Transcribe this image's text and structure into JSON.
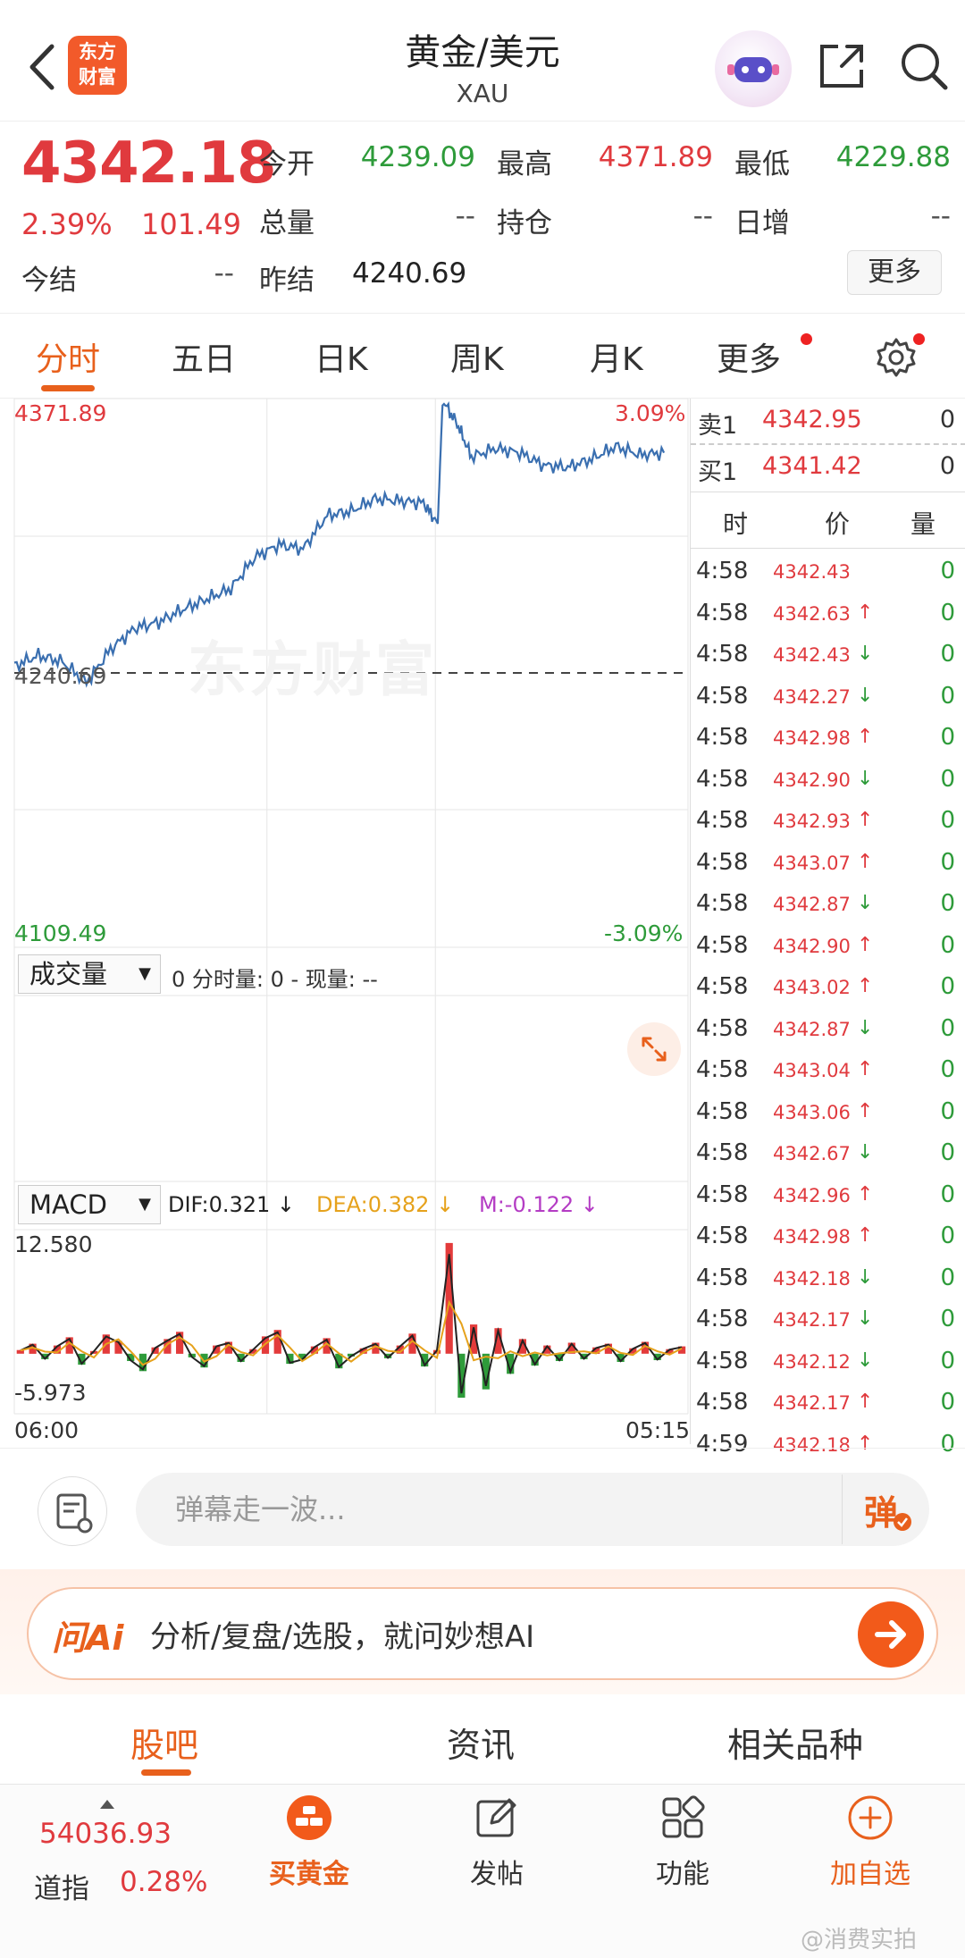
{
  "header": {
    "logo_line1": "东方",
    "logo_line2": "财富",
    "title": "黄金/美元",
    "subtitle": "XAU"
  },
  "quote": {
    "price": "4342.18",
    "change_pct": "2.39%",
    "change_abs": "101.49",
    "fields": [
      {
        "label": "今开",
        "value": "4239.09",
        "color": "green"
      },
      {
        "label": "最高",
        "value": "4371.89",
        "color": "red"
      },
      {
        "label": "最低",
        "value": "4229.88",
        "color": "green"
      },
      {
        "label": "总量",
        "value": "--",
        "color": "gray"
      },
      {
        "label": "持仓",
        "value": "--",
        "color": "gray"
      },
      {
        "label": "日增",
        "value": "--",
        "color": "gray"
      },
      {
        "label": "今结",
        "value": "--",
        "color": "gray"
      },
      {
        "label": "昨结",
        "value": "4240.69",
        "color": "gray"
      }
    ],
    "more_label": "更多"
  },
  "tabs": [
    "分时",
    "五日",
    "日K",
    "周K",
    "月K",
    "更多"
  ],
  "chart": {
    "y_max_label": "4371.89",
    "y_min_label": "4109.49",
    "y_mid_label": "4240.69",
    "pct_top": "3.09%",
    "pct_bottom": "-3.09%",
    "watermark": "东方财富",
    "volume_select": "成交量",
    "volume_info": "0 分时量: 0 - 现量: --",
    "macd_select": "MACD",
    "macd_dif": "DIF:0.321 ↓",
    "macd_dea": "DEA:0.382 ↓",
    "macd_m": "M:-0.122 ↓",
    "macd_top": "12.580",
    "macd_bottom": "-5.973",
    "time_start": "06:00",
    "time_end": "05:15"
  },
  "chart_data": {
    "type": "line",
    "series": [
      {
        "name": "",
        "points": [
          [
            0,
            4244
          ],
          [
            5,
            4249
          ],
          [
            10,
            4246
          ],
          [
            15,
            4236
          ],
          [
            20,
            4252
          ],
          [
            25,
            4262
          ],
          [
            30,
            4265
          ],
          [
            35,
            4271
          ],
          [
            40,
            4276
          ],
          [
            45,
            4281
          ],
          [
            50,
            4296
          ],
          [
            55,
            4302
          ],
          [
            60,
            4300
          ],
          [
            65,
            4316
          ],
          [
            70,
            4318
          ],
          [
            75,
            4324
          ],
          [
            80,
            4323
          ],
          [
            85,
            4322
          ],
          [
            88,
            4312
          ],
          [
            89,
            4371
          ],
          [
            92,
            4360
          ],
          [
            95,
            4344
          ],
          [
            100,
            4348
          ],
          [
            105,
            4346
          ],
          [
            110,
            4340
          ],
          [
            115,
            4339
          ],
          [
            120,
            4343
          ],
          [
            125,
            4349
          ],
          [
            130,
            4345
          ],
          [
            135,
            4346
          ]
        ]
      }
    ],
    "ylim": [
      4109.49,
      4371.89
    ],
    "reference": 4240.69,
    "xlabel": "",
    "ylabel": "",
    "x_ticks": [
      "06:00",
      "05:15"
    ]
  },
  "macd_data": {
    "ylim": [
      -5.973,
      12.58
    ],
    "values": [
      0.4,
      1.1,
      -0.6,
      0.9,
      1.8,
      -1.2,
      0.3,
      2.1,
      1.4,
      -0.8,
      -1.9,
      0.7,
      1.6,
      2.4,
      -0.4,
      -1.5,
      0.9,
      1.3,
      -0.9,
      0.5,
      1.9,
      2.6,
      -1.1,
      -0.7,
      0.8,
      1.7,
      -1.6,
      -0.3,
      0.6,
      1.2,
      -0.5,
      0.9,
      2.2,
      -1.4,
      0.4,
      12.1,
      -4.8,
      3.2,
      -3.9,
      2.8,
      -2.2,
      1.6,
      -1.3,
      0.9,
      -0.8,
      1.2,
      -0.6,
      0.7,
      1.1,
      -0.9,
      0.6,
      1.3,
      -0.7,
      0.5,
      0.8
    ]
  },
  "book": {
    "sell_label": "卖1",
    "sell_price": "4342.95",
    "sell_vol": "0",
    "buy_label": "买1",
    "buy_price": "4341.42",
    "buy_vol": "0",
    "col_time": "时",
    "col_price": "价",
    "col_vol": "量"
  },
  "ticks": [
    {
      "time": "4:58",
      "price": "4342.43",
      "dir": "",
      "vol": "0"
    },
    {
      "time": "4:58",
      "price": "4342.63",
      "dir": "↑",
      "vol": "0"
    },
    {
      "time": "4:58",
      "price": "4342.43",
      "dir": "↓",
      "vol": "0"
    },
    {
      "time": "4:58",
      "price": "4342.27",
      "dir": "↓",
      "vol": "0"
    },
    {
      "time": "4:58",
      "price": "4342.98",
      "dir": "↑",
      "vol": "0"
    },
    {
      "time": "4:58",
      "price": "4342.90",
      "dir": "↓",
      "vol": "0"
    },
    {
      "time": "4:58",
      "price": "4342.93",
      "dir": "↑",
      "vol": "0"
    },
    {
      "time": "4:58",
      "price": "4343.07",
      "dir": "↑",
      "vol": "0"
    },
    {
      "time": "4:58",
      "price": "4342.87",
      "dir": "↓",
      "vol": "0"
    },
    {
      "time": "4:58",
      "price": "4342.90",
      "dir": "↑",
      "vol": "0"
    },
    {
      "time": "4:58",
      "price": "4343.02",
      "dir": "↑",
      "vol": "0"
    },
    {
      "time": "4:58",
      "price": "4342.87",
      "dir": "↓",
      "vol": "0"
    },
    {
      "time": "4:58",
      "price": "4343.04",
      "dir": "↑",
      "vol": "0"
    },
    {
      "time": "4:58",
      "price": "4343.06",
      "dir": "↑",
      "vol": "0"
    },
    {
      "time": "4:58",
      "price": "4342.67",
      "dir": "↓",
      "vol": "0"
    },
    {
      "time": "4:58",
      "price": "4342.96",
      "dir": "↑",
      "vol": "0"
    },
    {
      "time": "4:58",
      "price": "4342.98",
      "dir": "↑",
      "vol": "0"
    },
    {
      "time": "4:58",
      "price": "4342.18",
      "dir": "↓",
      "vol": "0"
    },
    {
      "time": "4:58",
      "price": "4342.17",
      "dir": "↓",
      "vol": "0"
    },
    {
      "time": "4:58",
      "price": "4342.12",
      "dir": "↓",
      "vol": "0"
    },
    {
      "time": "4:58",
      "price": "4342.17",
      "dir": "↑",
      "vol": "0"
    },
    {
      "time": "4:59",
      "price": "4342.18",
      "dir": "↑",
      "vol": "0"
    }
  ],
  "comment": {
    "placeholder": "弹幕走一波...",
    "danmu_label": "弹"
  },
  "ai": {
    "logo": "问Ai",
    "text": "分析/复盘/选股，就问妙想AI"
  },
  "bottom_tabs": [
    "股吧",
    "资讯",
    "相关品种"
  ],
  "nav": {
    "index_value": "54036.93",
    "index_name": "道指",
    "index_pct": "0.28%",
    "items": [
      "买黄金",
      "发帖",
      "功能",
      "加自选"
    ]
  },
  "watermark_text": "@消费实拍",
  "colors": {
    "red": "#e03a3e",
    "green": "#2e9b3a",
    "accent": "#e8601c",
    "line": "#3a6fb0"
  }
}
